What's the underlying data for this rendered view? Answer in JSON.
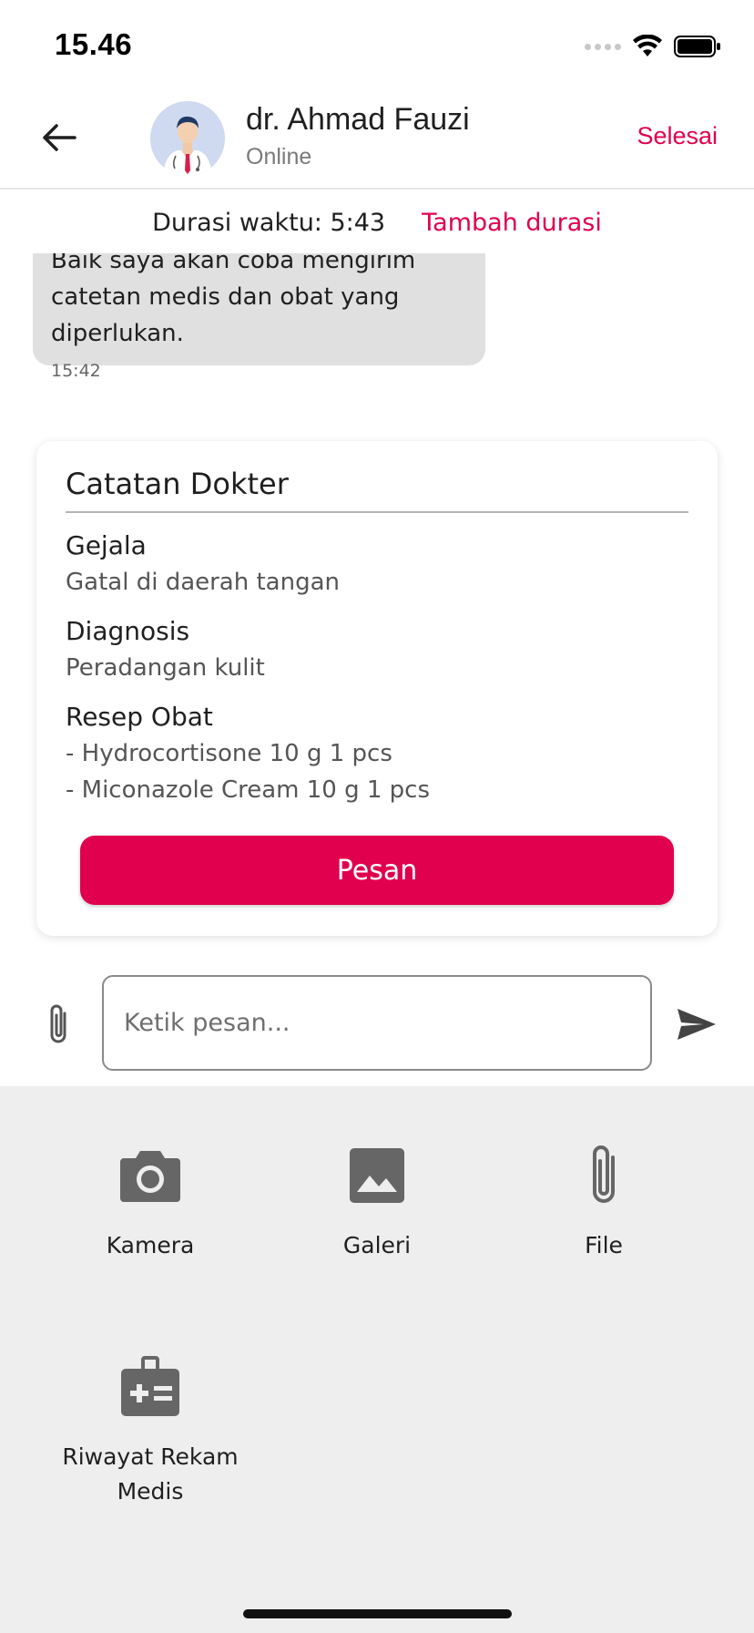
{
  "status_bar": {
    "time": "15.46"
  },
  "header": {
    "back_icon": "arrow-left-icon",
    "doctor_name": "dr. Ahmad Fauzi",
    "doctor_status": "Online",
    "finish_label": "Selesai"
  },
  "duration": {
    "text": "Durasi waktu: 5:43",
    "add_label": "Tambah durasi"
  },
  "chat": {
    "messages": [
      {
        "text": "Baik saya akan coba mengirim catetan medis dan obat yang diperlukan.",
        "time": "15:42"
      }
    ]
  },
  "doctor_note": {
    "title": "Catatan Dokter",
    "symptoms_label": "Gejala",
    "symptoms_value": "Gatal di daerah tangan",
    "diagnosis_label": "Diagnosis",
    "diagnosis_value": "Peradangan kulit",
    "prescription_label": "Resep Obat",
    "prescription_items": [
      "- Hydrocortisone 10 g 1 pcs",
      "- Miconazole Cream 10 g 1 pcs"
    ],
    "order_label": "Pesan"
  },
  "composer": {
    "placeholder": "Ketik pesan...",
    "attach_icon": "paperclip-icon",
    "send_icon": "send-icon"
  },
  "attachments": {
    "options": [
      {
        "label": "Kamera",
        "icon": "camera-icon"
      },
      {
        "label": "Galeri",
        "icon": "image-icon"
      },
      {
        "label": "File",
        "icon": "paperclip-icon"
      },
      {
        "label": "Riwayat Rekam Medis",
        "icon": "medical-record-icon"
      }
    ]
  },
  "colors": {
    "accent": "#e0004d",
    "panel_bg": "#eeeeee",
    "bubble_bg": "#e0e0e0",
    "icon_gray": "#666666"
  }
}
